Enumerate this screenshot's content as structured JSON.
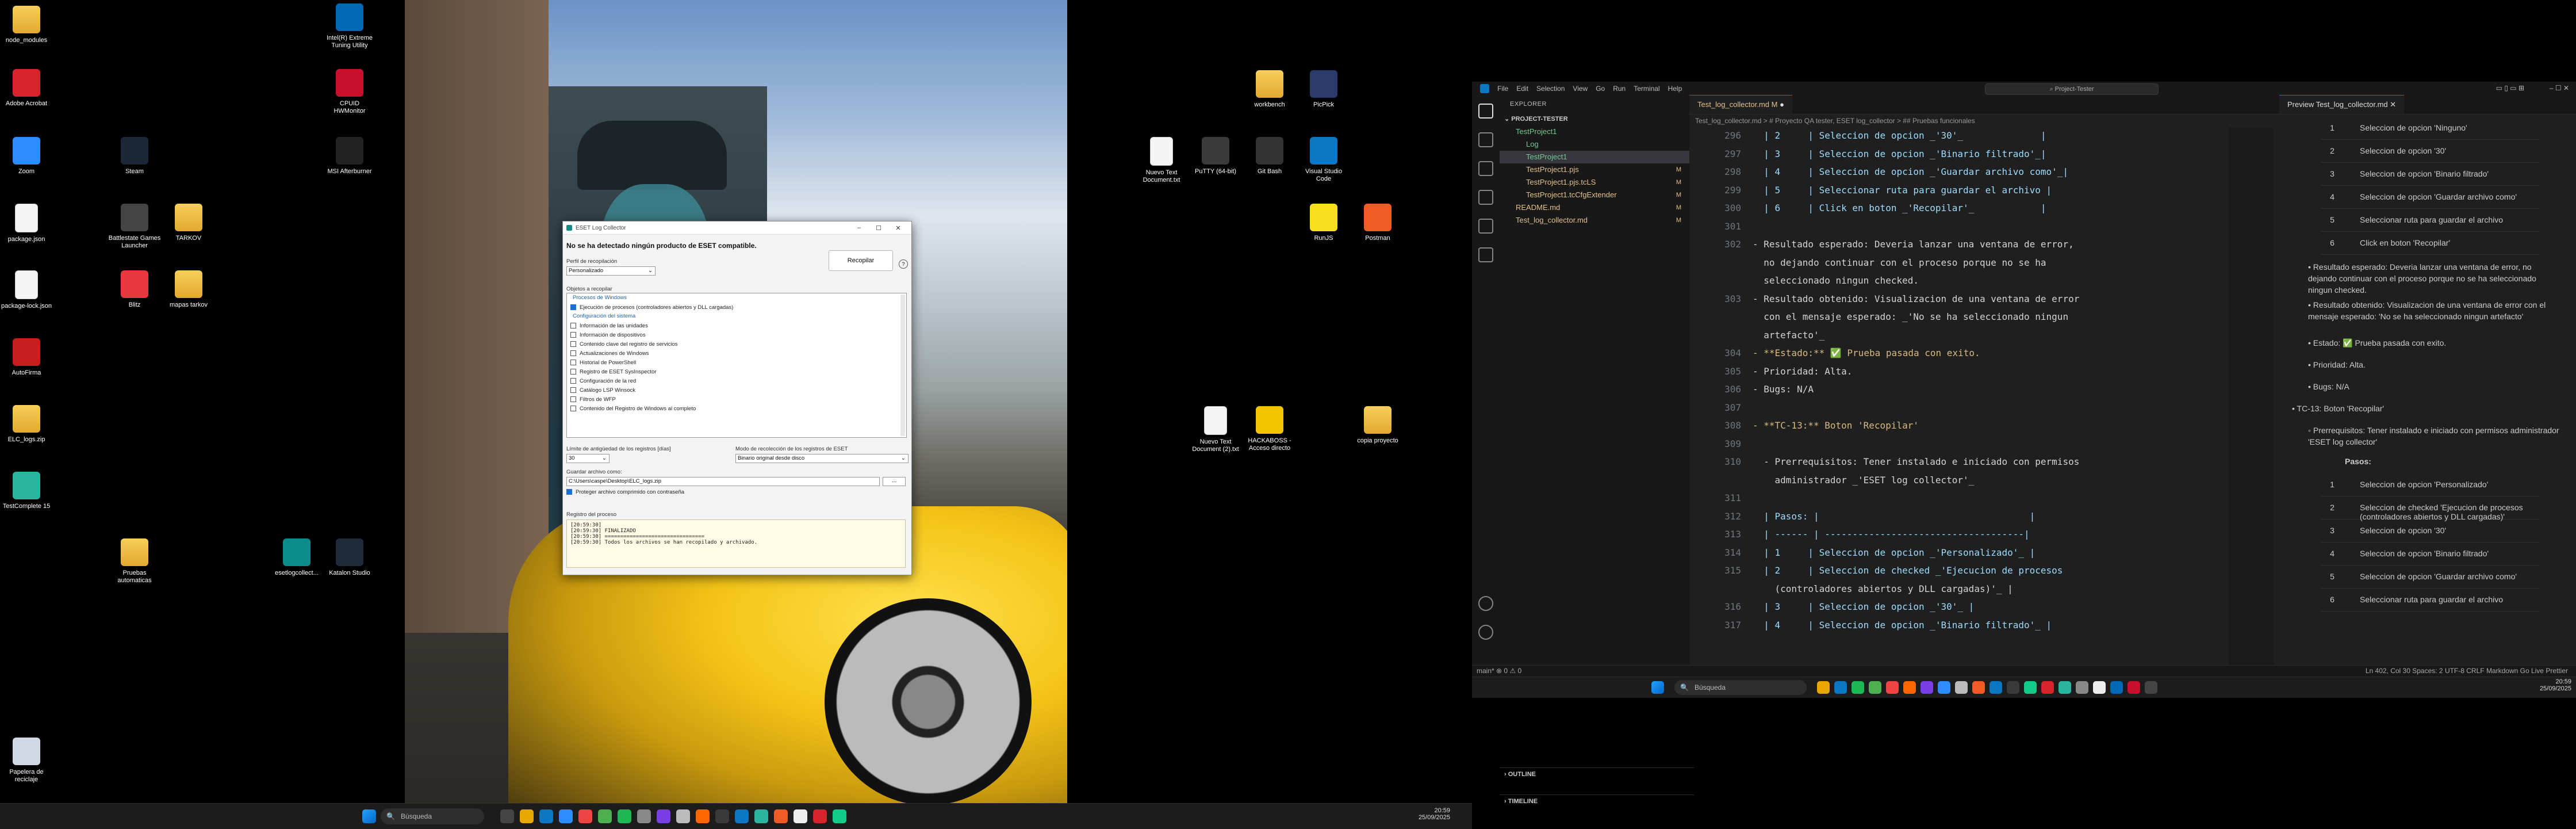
{
  "desktop_left": {
    "icons": [
      {
        "id": "i-node",
        "label": "node_modules",
        "kind": "folder"
      },
      {
        "id": "i-acrobat",
        "label": "Adobe Acrobat",
        "kind": "app",
        "color": "#d8232a"
      },
      {
        "id": "i-zoom",
        "label": "Zoom",
        "kind": "app",
        "color": "#2d8cff"
      },
      {
        "id": "i-packagejson",
        "label": "package.json",
        "kind": "file"
      },
      {
        "id": "i-packagelock",
        "label": "package-lock.json",
        "kind": "file"
      },
      {
        "id": "i-autofirma",
        "label": "AutoFirma",
        "kind": "app",
        "color": "#c81e1e"
      },
      {
        "id": "i-elcl",
        "label": "ELC_logs.zip",
        "kind": "zip"
      },
      {
        "id": "i-testcomplete",
        "label": "TestComplete 15",
        "kind": "app",
        "color": "#2bb5a0"
      },
      {
        "id": "i-papelera",
        "label": "Papelera de reciclaje",
        "kind": "app",
        "color": "#cfd8e3"
      },
      {
        "id": "i-steam",
        "label": "Steam",
        "kind": "app",
        "color": "#1b2838"
      },
      {
        "id": "i-battlestate",
        "label": "Battlestate Games Launcher",
        "kind": "app",
        "color": "#444"
      },
      {
        "id": "i-tarkov",
        "label": "TARKOV",
        "kind": "folder"
      },
      {
        "id": "i-blitz",
        "label": "Blitz",
        "kind": "app",
        "color": "#e8383d"
      },
      {
        "id": "i-mapas",
        "label": "mapas tarkov",
        "kind": "folder"
      },
      {
        "id": "i-pruebas",
        "label": "Pruebas automaticas",
        "kind": "folder"
      },
      {
        "id": "i-intel",
        "label": "Intel(R) Extreme Tuning Utility",
        "kind": "app",
        "color": "#0068b5"
      },
      {
        "id": "i-cpuid",
        "label": "CPUID HWMonitor",
        "kind": "app",
        "color": "#c8102e"
      },
      {
        "id": "i-msi",
        "label": "MSI Afterburner",
        "kind": "app",
        "color": "#222"
      },
      {
        "id": "i-esetlog",
        "label": "esetlogcollect...",
        "kind": "app",
        "color": "#0d8a8a"
      },
      {
        "id": "i-katalon",
        "label": "Katalon Studio",
        "kind": "app",
        "color": "#1c2a3a"
      },
      {
        "id": "i-workbench",
        "label": "workbench",
        "kind": "folder"
      },
      {
        "id": "i-picpick",
        "label": "PicPick",
        "kind": "app",
        "color": "#2a3a6a"
      },
      {
        "id": "i-newtxt",
        "label": "Nuevo Text Document.txt",
        "kind": "file"
      },
      {
        "id": "i-putty",
        "label": "PuTTY (64-bit)",
        "kind": "app",
        "color": "#3a3a3a"
      },
      {
        "id": "i-gitbash",
        "label": "Git Bash",
        "kind": "app",
        "color": "#333"
      },
      {
        "id": "i-vscode",
        "label": "Visual Studio Code",
        "kind": "app",
        "color": "#0a76c4"
      },
      {
        "id": "i-runjs",
        "label": "RunJS",
        "kind": "app",
        "color": "#f7df1e"
      },
      {
        "id": "i-postman",
        "label": "Postman",
        "kind": "app",
        "color": "#ef5b25"
      },
      {
        "id": "i-newtxt2",
        "label": "Nuevo Text Document (2).txt",
        "kind": "file"
      },
      {
        "id": "i-hackabo",
        "label": "HACKABOSS - Acceso directo",
        "kind": "app",
        "color": "#f5c400"
      },
      {
        "id": "i-copia",
        "label": "copia proyecto",
        "kind": "folder"
      }
    ],
    "taskbar": {
      "search": "Búsqueda",
      "time": "20:59",
      "date": "25/09/2025"
    }
  },
  "eset": {
    "title": "ESET Log Collector",
    "headline": "No se ha detectado ningún producto de ESET compatible.",
    "profile_label": "Perfil de recopilación",
    "profile_value": "Personalizado",
    "objects_label": "Objetos a recopilar",
    "collect_button": "Recopilar",
    "help": "?",
    "group_windows": "Procesos de Windows",
    "item_procesos": "Ejecución de procesos (controladores abiertos y DLL cargadas)",
    "group_config": "Configuración del sistema",
    "items": [
      "Información de las unidades",
      "Información de dispositivos",
      "Contenido clave del registro de servicios",
      "Actualizaciones de Windows",
      "Historial de PowerShell",
      "Registro de ESET SysInspector",
      "Configuración de la red",
      "Catálogo LSP Winsock",
      "Filtros de WFP",
      "Contenido del Registro de Windows al completo"
    ],
    "age_label": "Límite de antigüedad de los registros [días]",
    "age_value": "30",
    "mode_label": "Modo de recolección de los registros de ESET",
    "mode_value": "Binario original desde disco",
    "save_label": "Guardar archivo como:",
    "save_value": "C:\\Users\\caspe\\Desktop\\ELC_logs.zip",
    "browse": "...",
    "protect": "Proteger archivo comprimido con contraseña",
    "log_label": "Registro del proceso",
    "log_lines": [
      "[20:59:30]",
      "[20:59:30]  FINALIZADO",
      "[20:59:30]  ================================",
      "[20:59:30]  Todos los archivos se han recopilado y archivado."
    ]
  },
  "vscode": {
    "menu": [
      "File",
      "Edit",
      "Selection",
      "View",
      "Go",
      "Run",
      "Terminal",
      "Help"
    ],
    "command": "Project-Tester",
    "explorer_title": "EXPLORER",
    "project": "PROJECT-TESTER",
    "tree": [
      {
        "label": "TestProject1",
        "indent": 1,
        "color": "#73c991",
        "badge": ""
      },
      {
        "label": "Log",
        "indent": 2,
        "color": "#73c991",
        "badge": ""
      },
      {
        "label": "TestProject1",
        "indent": 2,
        "color": "#73c991",
        "badge": "",
        "selected": true
      },
      {
        "label": "TestProject1.pjs",
        "indent": 2,
        "color": "#e2c08d",
        "badge": "M"
      },
      {
        "label": "TestProject1.pjs.tcLS",
        "indent": 2,
        "color": "#e2c08d",
        "badge": "M"
      },
      {
        "label": "TestProject1.tcCfgExtender",
        "indent": 2,
        "color": "#e2c08d",
        "badge": "M"
      },
      {
        "label": "README.md",
        "indent": 1,
        "color": "#e2c08d",
        "badge": "M"
      },
      {
        "label": "Test_log_collector.md",
        "indent": 1,
        "color": "#e2c08d",
        "badge": "M"
      }
    ],
    "outline": "OUTLINE",
    "timeline": "TIMELINE",
    "tab1": "Test_log_collector.md M",
    "tab2": "Preview Test_log_collector.md",
    "breadcrumb": "Test_log_collector.md > # Proyecto QA tester, ESET log_collector > ## Pruebas funcionales",
    "code": [
      {
        "n": "296",
        "t": "  | 2     | Seleccion de opcion _'30'_              |"
      },
      {
        "n": "297",
        "t": "  | 3     | Seleccion de opcion _'Binario filtrado'_|"
      },
      {
        "n": "298",
        "t": "  | 4     | Seleccion de opcion _'Guardar archivo como'_|"
      },
      {
        "n": "299",
        "t": "  | 5     | Seleccionar ruta para guardar el archivo |"
      },
      {
        "n": "300",
        "t": "  | 6     | Click en boton _'Recopilar'_            |"
      },
      {
        "n": "301",
        "t": ""
      },
      {
        "n": "302",
        "t": "- Resultado esperado: Deveria lanzar una ventana de error,"
      },
      {
        "n": "",
        "t": "  no dejando continuar con el proceso porque no se ha"
      },
      {
        "n": "",
        "t": "  seleccionado ningun checked."
      },
      {
        "n": "303",
        "t": "- Resultado obtenido: Visualizacion de una ventana de error"
      },
      {
        "n": "",
        "t": "  con el mensaje esperado: _'No se ha seleccionado ningun"
      },
      {
        "n": "",
        "t": "  artefacto'_"
      },
      {
        "n": "304",
        "t": "- **Estado:** ✅ Prueba pasada con exito."
      },
      {
        "n": "305",
        "t": "- Prioridad: Alta."
      },
      {
        "n": "306",
        "t": "- Bugs: N/A"
      },
      {
        "n": "307",
        "t": ""
      },
      {
        "n": "308",
        "t": "- **TC-13:** Boton 'Recopilar'"
      },
      {
        "n": "309",
        "t": ""
      },
      {
        "n": "310",
        "t": "  - Prerrequisitos: Tener instalado e iniciado con permisos"
      },
      {
        "n": "",
        "t": "    administrador _'ESET log collector'_"
      },
      {
        "n": "311",
        "t": ""
      },
      {
        "n": "312",
        "t": "  | Pasos: |                                      |"
      },
      {
        "n": "313",
        "t": "  | ------ | ------------------------------------|"
      },
      {
        "n": "314",
        "t": "  | 1     | Seleccion de opcion _'Personalizado'_ |"
      },
      {
        "n": "315",
        "t": "  | 2     | Seleccion de checked _'Ejecucion de procesos"
      },
      {
        "n": "",
        "t": "    (controladores abiertos y DLL cargadas)'_ |"
      },
      {
        "n": "316",
        "t": "  | 3     | Seleccion de opcion _'30'_ |"
      },
      {
        "n": "317",
        "t": "  | 4     | Seleccion de opcion _'Binario filtrado'_ |"
      }
    ],
    "preview_top": [
      {
        "n": "1",
        "t": "Seleccion de opcion 'Ninguno'"
      },
      {
        "n": "2",
        "t": "Seleccion de opcion '30'"
      },
      {
        "n": "3",
        "t": "Seleccion de opcion 'Binario filtrado'"
      },
      {
        "n": "4",
        "t": "Seleccion de opcion 'Guardar archivo como'"
      },
      {
        "n": "5",
        "t": "Seleccionar ruta para guardar el archivo"
      },
      {
        "n": "6",
        "t": "Click en boton 'Recopilar'"
      }
    ],
    "preview_bullets": [
      "Resultado esperado: Deveria lanzar una ventana de error, no dejando continuar con el proceso porque no se ha seleccionado ningun checked.",
      "Resultado obtenido: Visualizacion de una ventana de error con el mensaje esperado: 'No se ha seleccionado ningun artefacto'",
      "Estado: ✅ Prueba pasada con exito.",
      "Prioridad: Alta.",
      "Bugs: N/A"
    ],
    "preview_tc13": "TC-13: Boton 'Recopilar'",
    "preview_prereq": "Prerrequisitos: Tener instalado e iniciado con permisos administrador 'ESET log collector'",
    "preview_pasos": "Pasos:",
    "preview_bottom": [
      {
        "n": "1",
        "t": "Seleccion de opcion 'Personalizado'"
      },
      {
        "n": "2",
        "t": "Seleccion de checked 'Ejecucion de procesos (controladores abiertos y DLL cargadas)'"
      },
      {
        "n": "3",
        "t": "Seleccion de opcion '30'"
      },
      {
        "n": "4",
        "t": "Seleccion de opcion 'Binario filtrado'"
      },
      {
        "n": "5",
        "t": "Seleccion de opcion 'Guardar archivo como'"
      },
      {
        "n": "6",
        "t": "Seleccionar ruta para guardar el archivo"
      }
    ],
    "status_left": "main*  ⊗ 0 ⚠ 0",
    "status_right": "Ln 402, Col 30   Spaces: 2   UTF-8   CRLF   Markdown   Go Live   Prettier",
    "taskbar": {
      "search": "Búsqueda",
      "time": "20:59",
      "date": "25/09/2025"
    }
  }
}
